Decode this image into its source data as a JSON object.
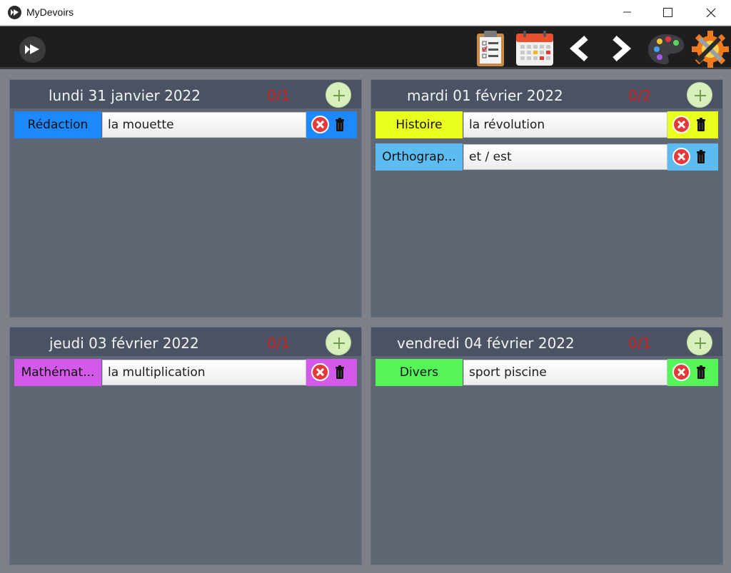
{
  "app": {
    "title": "MyDevoirs"
  },
  "toolbar": {
    "icons": [
      "clipboard-checklist-icon",
      "calendar-icon",
      "chevron-left-icon",
      "chevron-right-icon",
      "palette-icon",
      "settings-gear-icon"
    ]
  },
  "days": [
    {
      "title": "lundi 31 janvier 2022",
      "count": "0/1",
      "tasks": [
        {
          "subject": "Rédaction",
          "value": "la mouette",
          "color": "#1e88ff"
        }
      ]
    },
    {
      "title": "mardi 01 février 2022",
      "count": "0/2",
      "tasks": [
        {
          "subject": "Histoire",
          "value": "la révolution",
          "color": "#e9ff1e"
        },
        {
          "subject": "Orthograp...",
          "value": "et / est",
          "color": "#5cbcf0"
        }
      ]
    },
    {
      "title": "jeudi 03 février 2022",
      "count": "0/1",
      "tasks": [
        {
          "subject": "Mathémat...",
          "value": "la multiplication",
          "color": "#d35ae8"
        }
      ]
    },
    {
      "title": "vendredi 04 février 2022",
      "count": "0/1",
      "tasks": [
        {
          "subject": "Divers",
          "value": "sport piscine",
          "color": "#55f55a"
        }
      ]
    }
  ]
}
